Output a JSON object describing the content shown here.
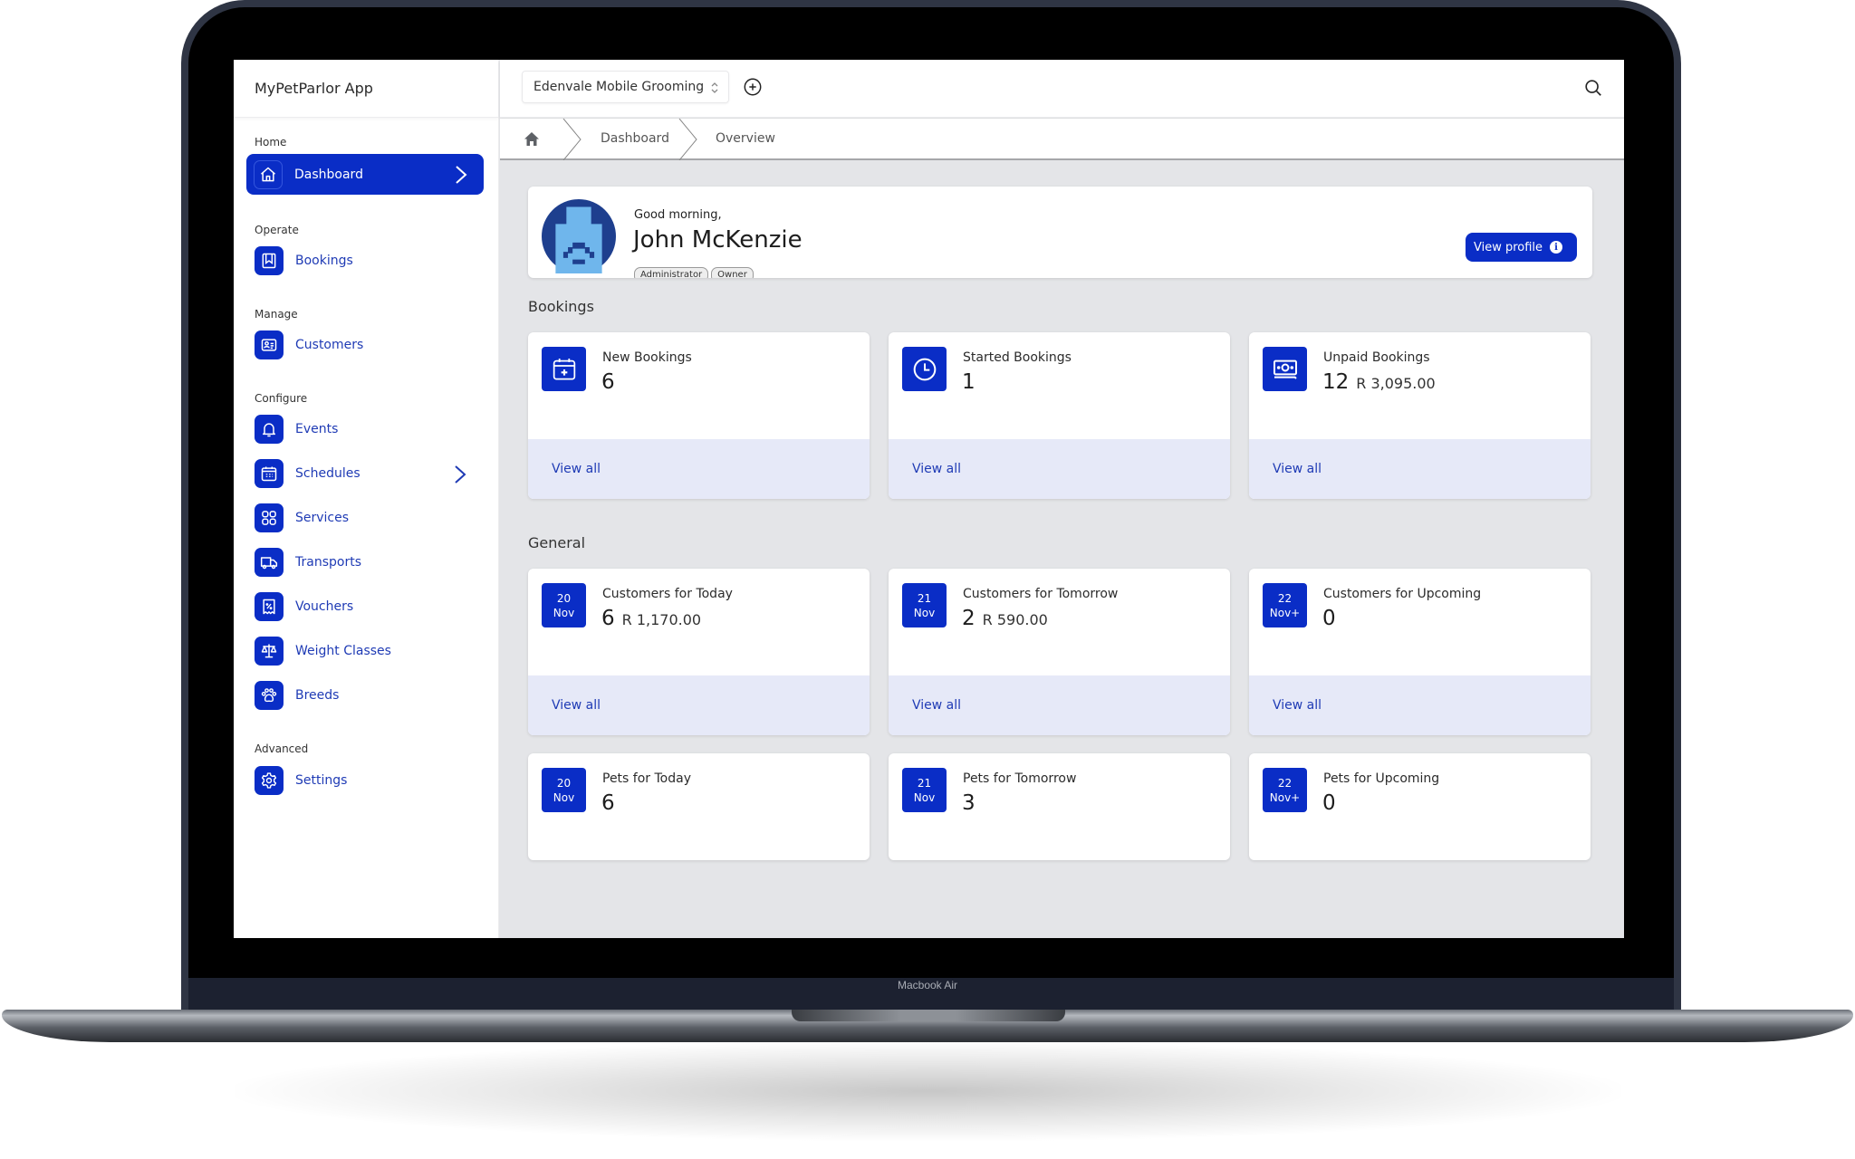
{
  "device": {
    "label": "Macbook Air"
  },
  "app": {
    "title": "MyPetParlor App"
  },
  "header": {
    "organization": "Edenvale Mobile Grooming",
    "user_name": "John McKenzie",
    "icons": [
      "updown-icon",
      "plus-circle-icon",
      "search-icon",
      "sun-icon",
      "chevron-down-icon"
    ]
  },
  "breadcrumb": {
    "items": [
      "Dashboard",
      "Overview"
    ]
  },
  "sidebar": {
    "sections": [
      {
        "title": "Home",
        "items": [
          {
            "label": "Dashboard",
            "icon": "home-icon",
            "active": true,
            "has_chevron": true
          }
        ]
      },
      {
        "title": "Operate",
        "items": [
          {
            "label": "Bookings",
            "icon": "bookmark-icon"
          }
        ]
      },
      {
        "title": "Manage",
        "items": [
          {
            "label": "Customers",
            "icon": "id-card-icon"
          }
        ]
      },
      {
        "title": "Configure",
        "items": [
          {
            "label": "Events",
            "icon": "bell-icon"
          },
          {
            "label": "Schedules",
            "icon": "calendar-icon",
            "has_chevron": true
          },
          {
            "label": "Services",
            "icon": "grid-icon"
          },
          {
            "label": "Transports",
            "icon": "truck-icon"
          },
          {
            "label": "Vouchers",
            "icon": "voucher-icon"
          },
          {
            "label": "Weight Classes",
            "icon": "scale-icon"
          },
          {
            "label": "Breeds",
            "icon": "paw-icon"
          }
        ]
      },
      {
        "title": "Advanced",
        "items": [
          {
            "label": "Settings",
            "icon": "gear-icon"
          }
        ]
      }
    ]
  },
  "welcome": {
    "greeting": "Good morning,",
    "name": "John McKenzie",
    "roles": [
      "Administrator",
      "Owner"
    ],
    "view_profile": "View profile"
  },
  "bookings": {
    "title": "Bookings",
    "cards": [
      {
        "title": "New Bookings",
        "value": "6",
        "amount": "",
        "icon": "calendar-plus-icon",
        "link": "View all"
      },
      {
        "title": "Started Bookings",
        "value": "1",
        "amount": "",
        "icon": "clock-icon",
        "link": "View all"
      },
      {
        "title": "Unpaid Bookings",
        "value": "12",
        "amount": "R 3,095.00",
        "icon": "money-icon",
        "link": "View all"
      }
    ]
  },
  "general": {
    "title": "General",
    "customers": [
      {
        "title": "Customers for Today",
        "day": "20",
        "month": "Nov",
        "value": "6",
        "amount": "R 1,170.00",
        "link": "View all"
      },
      {
        "title": "Customers for Tomorrow",
        "day": "21",
        "month": "Nov",
        "value": "2",
        "amount": "R 590.00",
        "link": "View all"
      },
      {
        "title": "Customers for Upcoming",
        "day": "22",
        "month": "Nov+",
        "value": "0",
        "amount": "",
        "link": "View all"
      }
    ],
    "pets": [
      {
        "title": "Pets for Today",
        "day": "20",
        "month": "Nov",
        "value": "6"
      },
      {
        "title": "Pets for Tomorrow",
        "day": "21",
        "month": "Nov",
        "value": "3"
      },
      {
        "title": "Pets for Upcoming",
        "day": "22",
        "month": "Nov+",
        "value": "0"
      }
    ]
  },
  "colors": {
    "primary": "#0a2dc6",
    "link": "#1f3bb5",
    "card_footer": "#e6e9f8",
    "content_bg": "#e4e5e8"
  }
}
